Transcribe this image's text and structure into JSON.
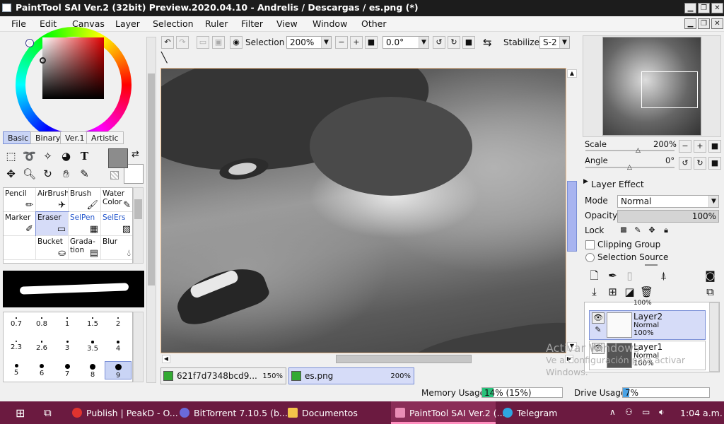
{
  "window": {
    "title": "PaintTool SAI Ver.2 (32bit) Preview.2020.04.10 - Andrelis / Descargas / es.png (*)"
  },
  "menu": [
    "File",
    "Edit",
    "Canvas",
    "Layer",
    "Selection",
    "Ruler",
    "Filter",
    "View",
    "Window",
    "Other"
  ],
  "color_tabs": [
    "Basic",
    "Binary",
    "Ver.1",
    "Artistic"
  ],
  "brushes": [
    {
      "label": "Pencil",
      "icon": "pencil-icon"
    },
    {
      "label": "AirBrush",
      "icon": "airbrush-icon"
    },
    {
      "label": "Brush",
      "icon": "brush-icon"
    },
    {
      "label": "Water Color",
      "icon": "watercolor-icon"
    },
    {
      "label": "Marker",
      "icon": "marker-icon"
    },
    {
      "label": "Eraser",
      "icon": "eraser-icon"
    },
    {
      "label": "SelPen",
      "icon": "selpen-icon"
    },
    {
      "label": "SelErs",
      "icon": "selers-icon"
    },
    {
      "label": "",
      "icon": ""
    },
    {
      "label": "Bucket",
      "icon": "bucket-icon"
    },
    {
      "label": "Grada-tion",
      "icon": "gradation-icon"
    },
    {
      "label": "Blur",
      "icon": "blur-icon"
    }
  ],
  "sizes": [
    "0.7",
    "0.8",
    "1",
    "1.5",
    "2",
    "2.3",
    "2.6",
    "3",
    "3.5",
    "4",
    "5",
    "6",
    "7",
    "8",
    "9"
  ],
  "toolbar": {
    "selection_label": "Selection",
    "zoom": "200%",
    "angle": "0.0°",
    "stabilizer_label": "Stabilizer",
    "stabilizer_value": "S-2"
  },
  "doc_tabs": [
    {
      "name": "621f7d7348bcd9...",
      "zoom": "150%"
    },
    {
      "name": "es.png",
      "zoom": "200%"
    }
  ],
  "status": {
    "memory_label": "Memory Usage",
    "memory_value": "14% (15%)",
    "memory_fraction": 0.14,
    "drive_label": "Drive Usage",
    "drive_value": "7%",
    "drive_fraction": 0.07
  },
  "navigator": {
    "scale_label": "Scale",
    "scale_value": "200%",
    "angle_label": "Angle",
    "angle_value": "0°"
  },
  "layer_panel": {
    "effect_label": "Layer Effect",
    "mode_label": "Mode",
    "mode_value": "Normal",
    "opacity_label": "Opacity",
    "opacity_value": "100%",
    "lock_label": "Lock",
    "clipping_label": "Clipping Group",
    "selection_source_label": "Selection Source",
    "top_partial": "100%",
    "layers": [
      {
        "name": "Layer2",
        "mode": "Normal",
        "opacity": "100%"
      },
      {
        "name": "Layer1",
        "mode": "Normal",
        "opacity": "100%"
      }
    ]
  },
  "watermark": {
    "line1": "Activar Windows",
    "line2": "Ve a Configuración para activar",
    "line3": "Windows."
  },
  "taskbar": {
    "items": [
      {
        "label": "Publish | PeakD - O...",
        "color": "#e0332f"
      },
      {
        "label": "BitTorrent 7.10.5  (b...",
        "color": "#6a6adb"
      },
      {
        "label": "Documentos",
        "color": "#f3c34a"
      },
      {
        "label": "PaintTool SAI Ver.2 (...",
        "color": "#e98db5"
      },
      {
        "label": "Telegram",
        "color": "#2da5e0"
      }
    ],
    "time": "1:04 a.m."
  }
}
